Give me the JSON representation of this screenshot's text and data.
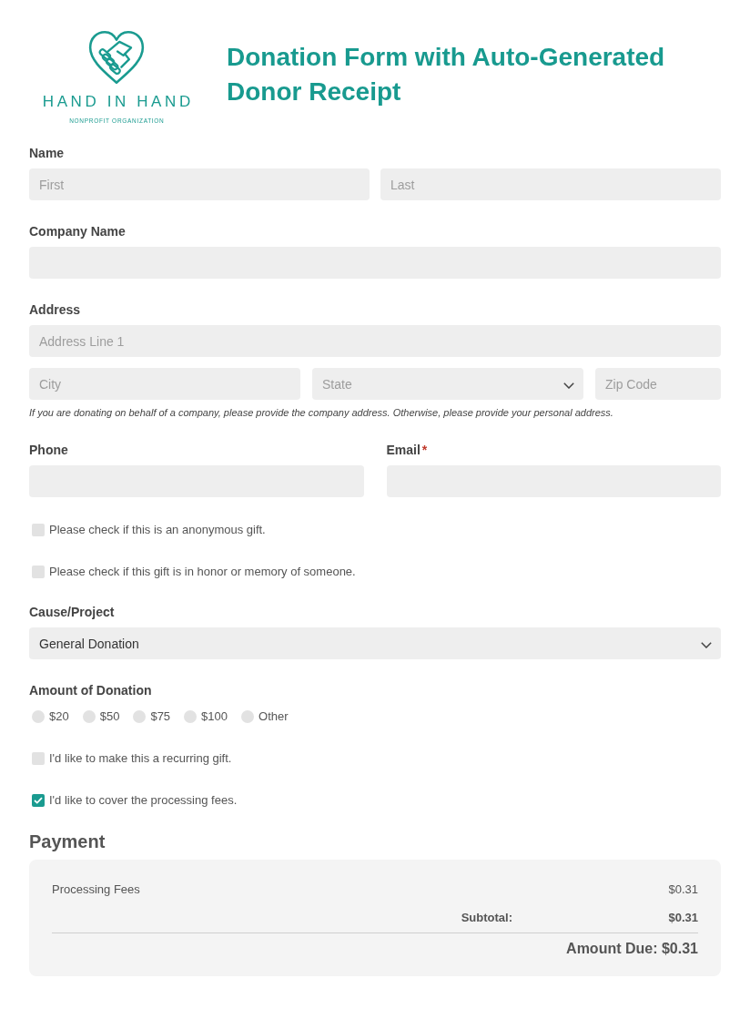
{
  "header": {
    "logo": {
      "name": "HAND IN HAND",
      "tagline": "NONPROFIT ORGANIZATION"
    },
    "title": "Donation Form with Auto-Generated Donor Receipt"
  },
  "form": [
    {
      "kind": "group",
      "label": "Name",
      "rows": [
        [
          {
            "kind": "text",
            "placeholder": "First"
          },
          {
            "kind": "text",
            "placeholder": "Last"
          }
        ]
      ]
    },
    {
      "kind": "group",
      "label": "Company Name",
      "rows": [
        [
          {
            "kind": "text"
          }
        ]
      ]
    },
    {
      "kind": "group",
      "label": "Address",
      "rows": [
        [
          {
            "kind": "text",
            "placeholder": "Address Line 1"
          }
        ],
        [
          {
            "kind": "text",
            "placeholder": "City"
          },
          {
            "kind": "select",
            "placeholder": "State"
          },
          {
            "kind": "text",
            "placeholder": "Zip Code"
          }
        ]
      ],
      "hint": "If you are donating on behalf of a company, please provide the company address. Otherwise, please provide your personal address."
    },
    {
      "kind": "pair",
      "items": [
        {
          "label": "Phone",
          "input": {
            "kind": "text"
          }
        },
        {
          "label": "Email",
          "required_mark": "*",
          "input": {
            "kind": "text"
          }
        }
      ]
    },
    {
      "kind": "checkbox",
      "label": "Please check if this is an anonymous gift.",
      "checked": false
    },
    {
      "kind": "checkbox",
      "label": "Please check if this gift is in honor or memory of someone.",
      "checked": false
    },
    {
      "kind": "group",
      "label": "Cause/Project",
      "rows": [
        [
          {
            "kind": "select",
            "value": "General Donation"
          }
        ]
      ]
    },
    {
      "kind": "radios",
      "label": "Amount of Donation",
      "options": [
        {
          "label": "$20",
          "selected": false
        },
        {
          "label": "$50",
          "selected": false
        },
        {
          "label": "$75",
          "selected": false
        },
        {
          "label": "$100",
          "selected": false
        },
        {
          "label": "Other",
          "selected": false
        }
      ]
    },
    {
      "kind": "checkbox",
      "label": "I'd like to make this a recurring gift.",
      "checked": false
    },
    {
      "kind": "checkbox",
      "label": "I'd like to cover the processing fees.",
      "checked": true
    }
  ],
  "payment": {
    "title": "Payment",
    "lines": [
      {
        "label": "Processing Fees",
        "amount": "$0.31"
      }
    ],
    "subtotal": {
      "label": "Subtotal:",
      "amount": "$0.31"
    },
    "total": "Amount Due: $0.31"
  }
}
